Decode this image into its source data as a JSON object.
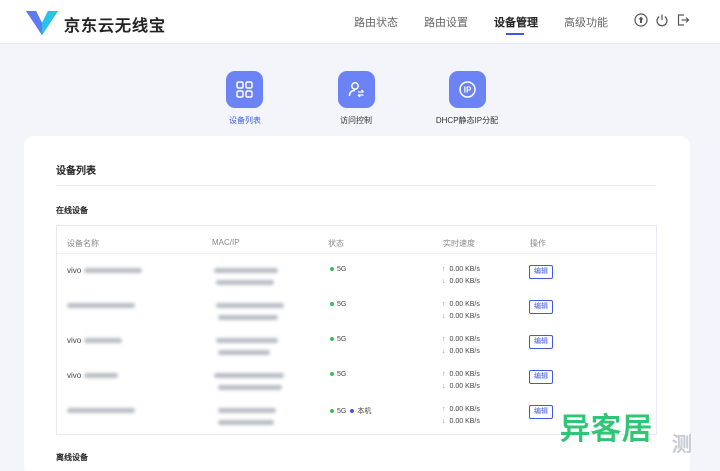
{
  "header": {
    "brand": "京东云无线宝",
    "nav": [
      "路由状态",
      "路由设置",
      "设备管理",
      "高级功能"
    ],
    "active_nav": "设备管理",
    "icons": [
      "upgrade-icon",
      "power-icon",
      "logout-icon"
    ]
  },
  "tiles": [
    {
      "label": "设备列表",
      "icon": "grid-icon",
      "active": true
    },
    {
      "label": "访问控制",
      "icon": "user-access-icon",
      "active": false
    },
    {
      "label": "DHCP静态IP分配",
      "icon": "ip-icon",
      "active": false
    }
  ],
  "card": {
    "title": "设备列表",
    "online_title": "在线设备",
    "offline_title": "离线设备"
  },
  "table": {
    "headers": [
      "设备名称",
      "MAC/IP",
      "状态",
      "实时速度",
      "操作"
    ],
    "rows": [
      {
        "name_prefix": "vivo",
        "status": "5G",
        "local": "",
        "up": "0.00 KB/s",
        "down": "0.00 KB/s",
        "action": "编辑"
      },
      {
        "name_prefix": "",
        "status": "5G",
        "local": "",
        "up": "0.00 KB/s",
        "down": "0.00 KB/s",
        "action": "编辑"
      },
      {
        "name_prefix": "vivo",
        "status": "5G",
        "local": "",
        "up": "0.00 KB/s",
        "down": "0.00 KB/s",
        "action": "编辑"
      },
      {
        "name_prefix": "vivo",
        "status": "5G",
        "local": "",
        "up": "0.00 KB/s",
        "down": "0.00 KB/s",
        "action": "编辑"
      },
      {
        "name_prefix": "",
        "status": "5G",
        "local": "本机",
        "up": "0.00 KB/s",
        "down": "0.00 KB/s",
        "action": "编辑"
      }
    ]
  },
  "watermark": {
    "main": "异客居",
    "small": "测"
  },
  "colors": {
    "accent": "#3f59e4",
    "tile": "#6b83f5",
    "online": "#33c25c",
    "watermark": "#20c26a"
  }
}
